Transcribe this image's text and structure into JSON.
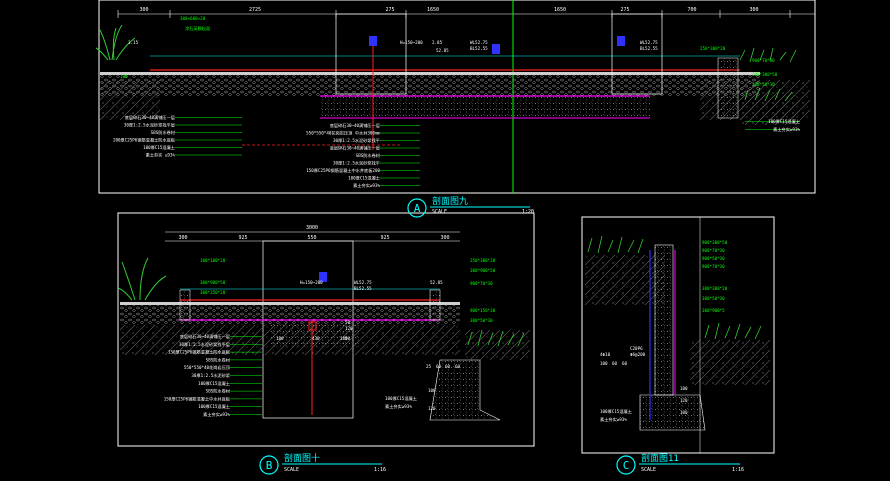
{
  "colors": {
    "background": "#000000",
    "frame": "#ffffff",
    "dim": "#ffffff",
    "leader": "#00ff00",
    "title": "#00ffff",
    "red": "#ff2020",
    "magenta": "#ff00ff",
    "blue": "#3030ff",
    "cyan": "#00ffff",
    "hatch": "#8a8a8a",
    "grass": "#33cc33"
  },
  "sectionA": {
    "marker": "A",
    "title": "剖面图九",
    "scale_label": "SCALE",
    "scale": "1:20",
    "dims": [
      "300",
      "2725",
      "275",
      "1650",
      "1650",
      "275",
      "700",
      "300"
    ],
    "notes": [
      "300×600×20",
      "涂石英颗粒面",
      "3.15",
      "2.85",
      "H=150~200",
      "52.85",
      "WL52.75",
      "BL52.55",
      "WL52.75",
      "BL52.55",
      "250*300*20",
      "900*70*30",
      "100",
      "300*300*50",
      "300*50*30"
    ],
    "layers_left": [
      "底层碎石30~40满铺压一层",
      "30厚1:2.5水泥砂浆找平层",
      "SBS防水卷材",
      "200厚C25P6钢筋混凝土防水底板",
      "100厚C15混凝土",
      "素土夯实 ≥93%"
    ],
    "layers_mid": [
      "底层碎石30~40满铺压一层",
      "550*550*40花岗岩压顶 中水井300mm",
      "30厚1:2.5水泥砂浆找平",
      "底层碎石30~40满铺压一层",
      "SBS防水卷材",
      "30厚1:2.5水泥砂浆找平",
      "150厚C25P6钢筋混凝土中水井底板200",
      "100厚C15混凝土",
      "素土夯实≥93%"
    ],
    "layers_right": [
      "100厚C15混凝土",
      "素土夯实≥93%"
    ]
  },
  "sectionB": {
    "marker": "B",
    "title": "剖面图十",
    "scale_label": "SCALE",
    "scale": "1:16",
    "dims": [
      "3000",
      "300",
      "925",
      "550",
      "925",
      "300"
    ],
    "notes": [
      "100*100*20",
      "300*900*50",
      "300*250*20",
      "H=150~200",
      "WL52.75",
      "BL52.55",
      "52.85",
      "250*300*20",
      "300*900*50",
      "900*70*30",
      "900*150*30",
      "300*50*30",
      "180",
      "430",
      "50",
      "120",
      "50",
      "180",
      "25",
      "60",
      "60",
      "60",
      "100",
      "120"
    ],
    "layers": [
      "底层碎石30~40满铺压一层",
      "30厚1:2.5水泥砂浆找平层",
      "150厚C25P6钢筋混凝土防水底板",
      "SBS防水卷材",
      "550*550*40花岗岩压顶",
      "30厚1:2.5水泥砂浆",
      "100厚C15混凝土",
      "SBS防水卷材",
      "150厚C25P6钢筋混凝土中水井底板",
      "100厚C15混凝土",
      "素土夯实≥93%"
    ],
    "layers_right": [
      "100厚C15混凝土",
      "素土夯实≥93%"
    ]
  },
  "sectionC": {
    "marker": "C",
    "title": "剖面图11",
    "scale_label": "SCALE",
    "scale": "1:16",
    "notes": [
      "900*300*50",
      "900*70*30",
      "900*50*30",
      "900*70*30",
      "300*300*20",
      "300*50*30",
      "300*900*5",
      "C20P6",
      "4Φ10",
      "Φ6@200",
      "100",
      "60",
      "60",
      "100",
      "120",
      "100"
    ],
    "layers": [
      "100厚C15混凝土",
      "素土夯实≥93%"
    ]
  }
}
